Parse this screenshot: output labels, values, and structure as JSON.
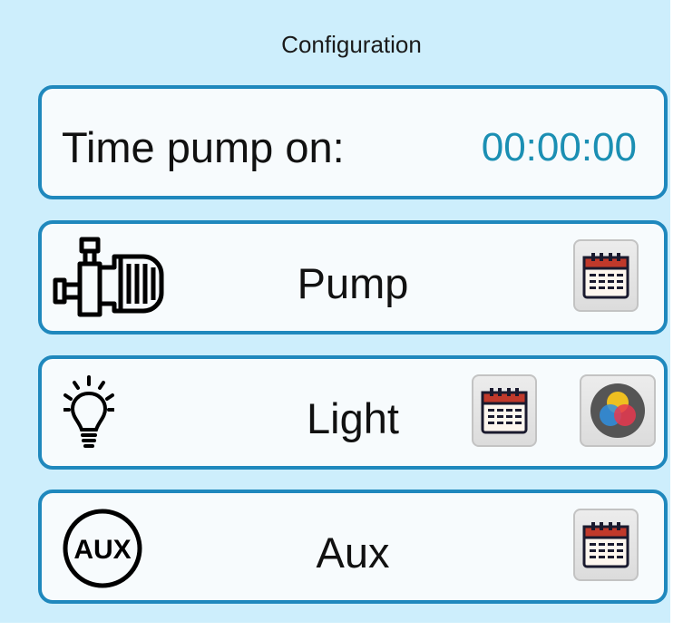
{
  "header": {
    "title": "Configuration"
  },
  "time": {
    "label": "Time pump on:",
    "value": "00:00:00"
  },
  "devices": [
    {
      "label": "Pump",
      "icon": "pump-icon",
      "buttons": [
        "calendar-icon"
      ]
    },
    {
      "label": "Light",
      "icon": "light-bulb-icon",
      "buttons": [
        "calendar-icon",
        "color-wheel-icon"
      ]
    },
    {
      "label": "Aux",
      "icon": "aux-icon",
      "buttons": [
        "calendar-icon"
      ]
    }
  ],
  "colors": {
    "background": "#cdeefc",
    "card_border": "#1f88bd",
    "time_value": "#1b8fb3",
    "calendar_header": "#c0392b"
  }
}
